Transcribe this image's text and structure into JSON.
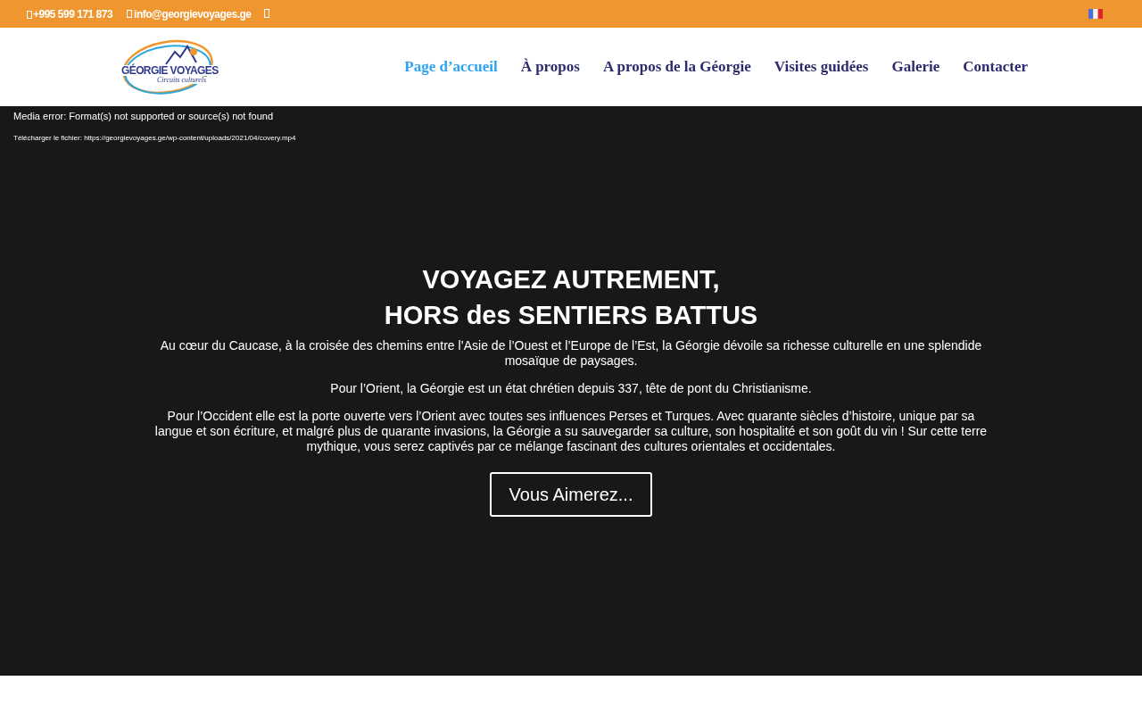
{
  "top_bar": {
    "phone": "+995 599 171 873",
    "email": "info@georgievoyages.ge"
  },
  "logo": {
    "name": "GÉORGIE VOYAGES",
    "tagline": "Circuits culturels"
  },
  "nav": [
    {
      "label": "Page d’accueil",
      "selected": true
    },
    {
      "label": "À propos",
      "selected": false
    },
    {
      "label": "A propos de la Géorgie",
      "selected": false
    },
    {
      "label": "Visites guidées",
      "selected": false
    },
    {
      "label": "Galerie",
      "selected": false
    },
    {
      "label": "Contacter",
      "selected": false
    }
  ],
  "media_error": {
    "message": "Media error: Format(s) not supported or source(s) not found",
    "download": "Télécharger le fichier: https://georgievoyages.ge/wp-content/uploads/2021/04/covery.mp4"
  },
  "hero": {
    "title_lines": [
      "VOYAGEZ AUTREMENT,",
      "HORS des SENTIERS BATTUS"
    ],
    "paragraphs": [
      "Au cœur du Caucase, à la croisée des chemins entre l’Asie de l’Ouest et l’Europe de l’Est, la Géorgie dévoile sa richesse culturelle en une splendide mosaïque de paysages.",
      "Pour l’Orient, la Géorgie est un état chrétien depuis 337, tête de pont du Christianisme.",
      "Pour l’Occident elle est la porte ouverte vers l’Orient avec toutes ses influences Perses et Turques. Avec quarante siècles d’histoire, unique par sa langue et son écriture, et malgré plus de quarante invasions, la Géorgie a su sauvegarder sa culture, son hospitalité et son goût du vin ! Sur cette terre mythique, vous serez captivés par ce mélange fascinant des cultures orientales et occidentales."
    ],
    "button": "Vous Aimerez..."
  }
}
